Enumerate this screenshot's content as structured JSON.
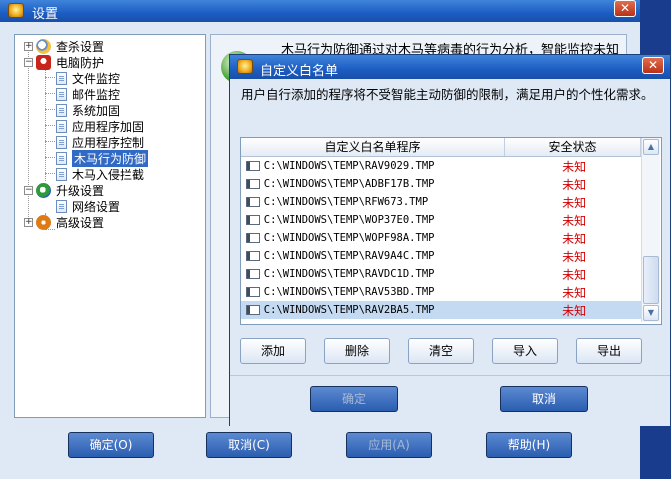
{
  "main_window": {
    "title": "设置",
    "close_label": "✕",
    "tree": [
      {
        "label": "查杀设置",
        "level": 0,
        "expander": "+",
        "icon": "search-settings-icon"
      },
      {
        "label": "电脑防护",
        "level": 0,
        "expander": "−",
        "icon": "shield-icon"
      },
      {
        "label": "文件监控",
        "level": 1
      },
      {
        "label": "邮件监控",
        "level": 1
      },
      {
        "label": "系统加固",
        "level": 1
      },
      {
        "label": "应用程序加固",
        "level": 1
      },
      {
        "label": "应用程序控制",
        "level": 1
      },
      {
        "label": "木马行为防御",
        "level": 1,
        "selected": true
      },
      {
        "label": "木马入侵拦截",
        "level": 1
      },
      {
        "label": "升级设置",
        "level": 0,
        "expander": "−",
        "icon": "update-icon"
      },
      {
        "label": "网络设置",
        "level": 1
      },
      {
        "label": "高级设置",
        "level": 0,
        "expander": "+",
        "icon": "advanced-settings-icon"
      }
    ],
    "right_description": "木马行为防御通过对木马等病毒的行为分析，智能监控未知",
    "buttons": {
      "ok": "确定(O)",
      "cancel": "取消(C)",
      "apply": "应用(A)",
      "help": "帮助(H)"
    }
  },
  "dialog": {
    "title": "自定义白名单",
    "close_label": "✕",
    "description": "用户自行添加的程序将不受智能主动防御的限制，满足用户的个性化需求。",
    "columns": [
      "自定义白名单程序",
      "安全状态"
    ],
    "rows": [
      {
        "path": "C:\\WINDOWS\\TEMP\\RAV9029.TMP",
        "status": "未知"
      },
      {
        "path": "C:\\WINDOWS\\TEMP\\ADBF17B.TMP",
        "status": "未知"
      },
      {
        "path": "C:\\WINDOWS\\TEMP\\RFW673.TMP",
        "status": "未知"
      },
      {
        "path": "C:\\WINDOWS\\TEMP\\WOP37E0.TMP",
        "status": "未知"
      },
      {
        "path": "C:\\WINDOWS\\TEMP\\WOPF98A.TMP",
        "status": "未知"
      },
      {
        "path": "C:\\WINDOWS\\TEMP\\RAV9A4C.TMP",
        "status": "未知"
      },
      {
        "path": "C:\\WINDOWS\\TEMP\\RAVDC1D.TMP",
        "status": "未知"
      },
      {
        "path": "C:\\WINDOWS\\TEMP\\RAV53BD.TMP",
        "status": "未知"
      },
      {
        "path": "C:\\WINDOWS\\TEMP\\RAV2BA5.TMP",
        "status": "未知",
        "selected": true
      }
    ],
    "actions": {
      "add": "添加",
      "delete": "删除",
      "clear": "清空",
      "import": "导入",
      "export": "导出"
    },
    "ok": "确定",
    "cancel": "取消"
  }
}
